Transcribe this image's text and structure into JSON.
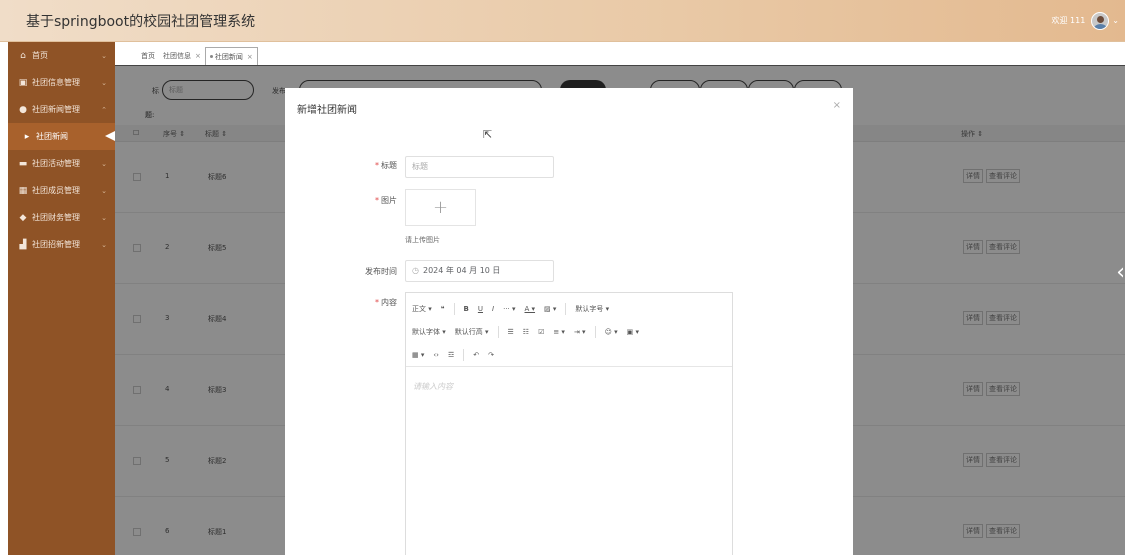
{
  "header": {
    "title": "基于springboot的校园社团管理系统",
    "welcome": "欢迎 111"
  },
  "sidebar": {
    "items": [
      {
        "label": "首页",
        "icon": "home-icon",
        "glyph": "⌂"
      },
      {
        "label": "社团信息管理",
        "icon": "info-icon",
        "glyph": "▣"
      },
      {
        "label": "社团新闻管理",
        "icon": "news-icon",
        "glyph": "●"
      },
      {
        "label": "社团新闻",
        "icon": "caret-right-icon",
        "glyph": "▸"
      },
      {
        "label": "社团活动管理",
        "icon": "activity-icon",
        "glyph": "▬"
      },
      {
        "label": "社团成员管理",
        "icon": "member-icon",
        "glyph": "▦"
      },
      {
        "label": "社团财务管理",
        "icon": "finance-icon",
        "glyph": "◆"
      },
      {
        "label": "社团招新管理",
        "icon": "recruit-icon",
        "glyph": "▟"
      }
    ]
  },
  "tabs": [
    {
      "label": "首页"
    },
    {
      "label": "社团信息"
    },
    {
      "label": "社团新闻"
    }
  ],
  "search": {
    "title_label": "标",
    "title_placeholder": "标题",
    "pub_label": "发布",
    "extra": "作"
  },
  "subrow": {
    "label": "题:"
  },
  "table": {
    "headers": {
      "index": "序号 ⇕",
      "title": "标题 ⇕",
      "ops": "操作 ⇕"
    },
    "rows": [
      {
        "index": "1",
        "title": "标题6"
      },
      {
        "index": "2",
        "title": "标题5"
      },
      {
        "index": "3",
        "title": "标题4"
      },
      {
        "index": "4",
        "title": "标题3"
      },
      {
        "index": "5",
        "title": "标题2"
      },
      {
        "index": "6",
        "title": "标题1"
      }
    ],
    "op_detail": "详情",
    "op_comment": "查看评论"
  },
  "dialog": {
    "title": "新增社团新闻",
    "close": "×",
    "fields": {
      "title_label": "标题",
      "title_placeholder": "标题",
      "image_label": "图片",
      "upload_tip": "请上传图片",
      "time_label": "发布时间",
      "time_value": "2024 年 04 月 10 日",
      "content_label": "内容"
    },
    "editor": {
      "row1": [
        "正文 ▾",
        "❝",
        "B",
        "U",
        "I",
        "··· ▾",
        "A ▾",
        "▨ ▾",
        "默认字号 ▾"
      ],
      "row2": [
        "默认字体 ▾",
        "默认行高 ▾",
        "☰",
        "☷",
        "☑",
        "≡ ▾",
        "⇥ ▾",
        "☺ ▾",
        "▣ ▾"
      ],
      "row3": [
        "▦ ▾",
        "‹›",
        "☲",
        "↶",
        "↷"
      ],
      "placeholder": "请输入内容"
    }
  }
}
